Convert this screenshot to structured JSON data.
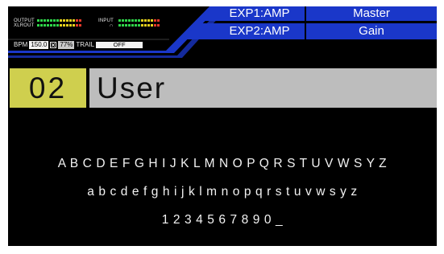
{
  "meters": {
    "output_label": "OUTPUT",
    "xlrout_label": "XLROUT",
    "input_label": "INPUT",
    "headphone_label": "∩"
  },
  "status": {
    "bpm_label": "BPM",
    "bpm_value": "150.0",
    "percent_value": "77%",
    "trail_label": "TRAIL",
    "trail_value": "OFF"
  },
  "exp": {
    "exp1_label": "EXP1:AMP",
    "exp1_value": "Master",
    "exp2_label": "EXP2:AMP",
    "exp2_value": "Gain"
  },
  "patch": {
    "number": "02",
    "name": "User"
  },
  "char_rows": {
    "upper": "A B C D E F G H I J K L M N O P Q R S T U V W S Y Z",
    "lower": "a b c d e f g h i j k l m n o p q r s t u v w s y z",
    "digits": "1 2 3 4 5 6 7 8 9 0 _"
  },
  "colors": {
    "background": "#000000",
    "exp_blue": "#1a37c9",
    "number_bg": "#cfcf4e",
    "name_bg": "#bdbdbd",
    "meter_green": "#2fd64a",
    "meter_yellow": "#e9d21c",
    "meter_red": "#e53a2b"
  }
}
